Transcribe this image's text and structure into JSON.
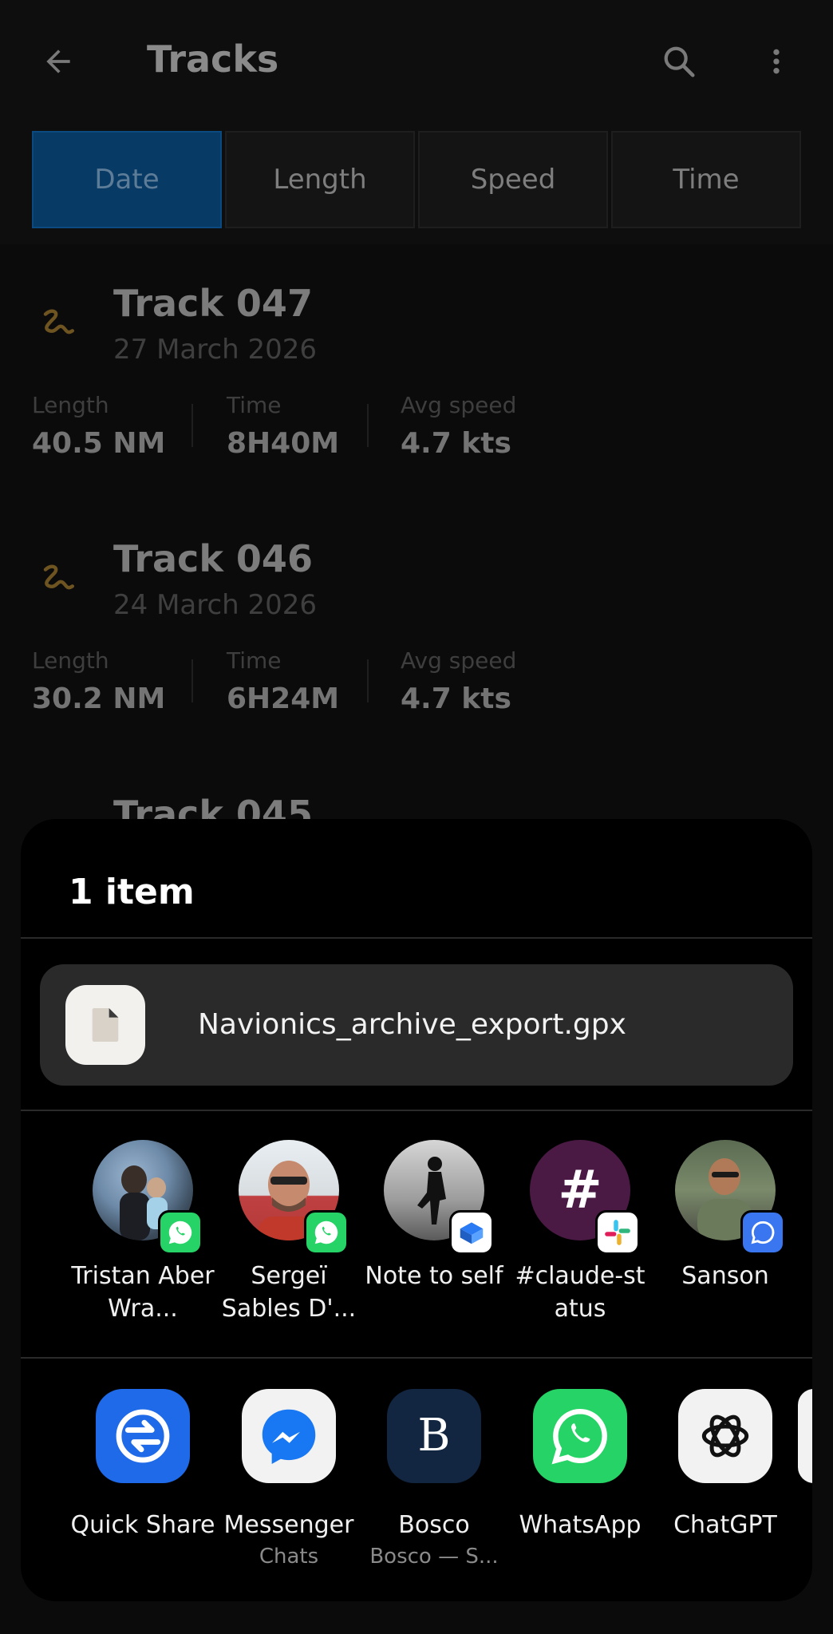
{
  "app": {
    "title": "Tracks",
    "tabs": [
      {
        "label": "Date",
        "active": true
      },
      {
        "label": "Length",
        "active": false
      },
      {
        "label": "Speed",
        "active": false
      },
      {
        "label": "Time",
        "active": false
      }
    ],
    "stat_labels": {
      "length": "Length",
      "time": "Time",
      "avg_speed": "Avg speed"
    },
    "tracks": [
      {
        "title": "Track 047",
        "date": "27 March 2026",
        "length": "40.5 NM",
        "time": "8H40M",
        "avg_speed": "4.7 kts"
      },
      {
        "title": "Track 046",
        "date": "24 March 2026",
        "length": "30.2 NM",
        "time": "6H24M",
        "avg_speed": "4.7 kts"
      },
      {
        "title": "Track 045"
      }
    ],
    "accent_color": "#0a5ca8",
    "track_icon_color": "#b8892c"
  },
  "share_sheet": {
    "title": "1 item",
    "file": {
      "name": "Navionics_archive_export.gpx",
      "icon": "file-icon"
    },
    "contacts": [
      {
        "name": "Tristan Aber Wra...",
        "badge": "whatsapp-icon"
      },
      {
        "name": "Sergeï Sables D'...",
        "badge": "whatsapp-icon"
      },
      {
        "name": "Note to self",
        "badge": "signal-notes-icon"
      },
      {
        "name": "#claude-st atus",
        "badge": "slack-icon"
      },
      {
        "name": "Sanson",
        "badge": "signal-icon"
      }
    ],
    "apps": [
      {
        "name": "Quick Share",
        "sub": ""
      },
      {
        "name": "Messenger",
        "sub": "Chats"
      },
      {
        "name": "Bosco",
        "sub": "Bosco — S..."
      },
      {
        "name": "WhatsApp",
        "sub": ""
      },
      {
        "name": "ChatGPT",
        "sub": ""
      }
    ],
    "bosco_letter": "B",
    "hashtag_glyph": "#"
  }
}
